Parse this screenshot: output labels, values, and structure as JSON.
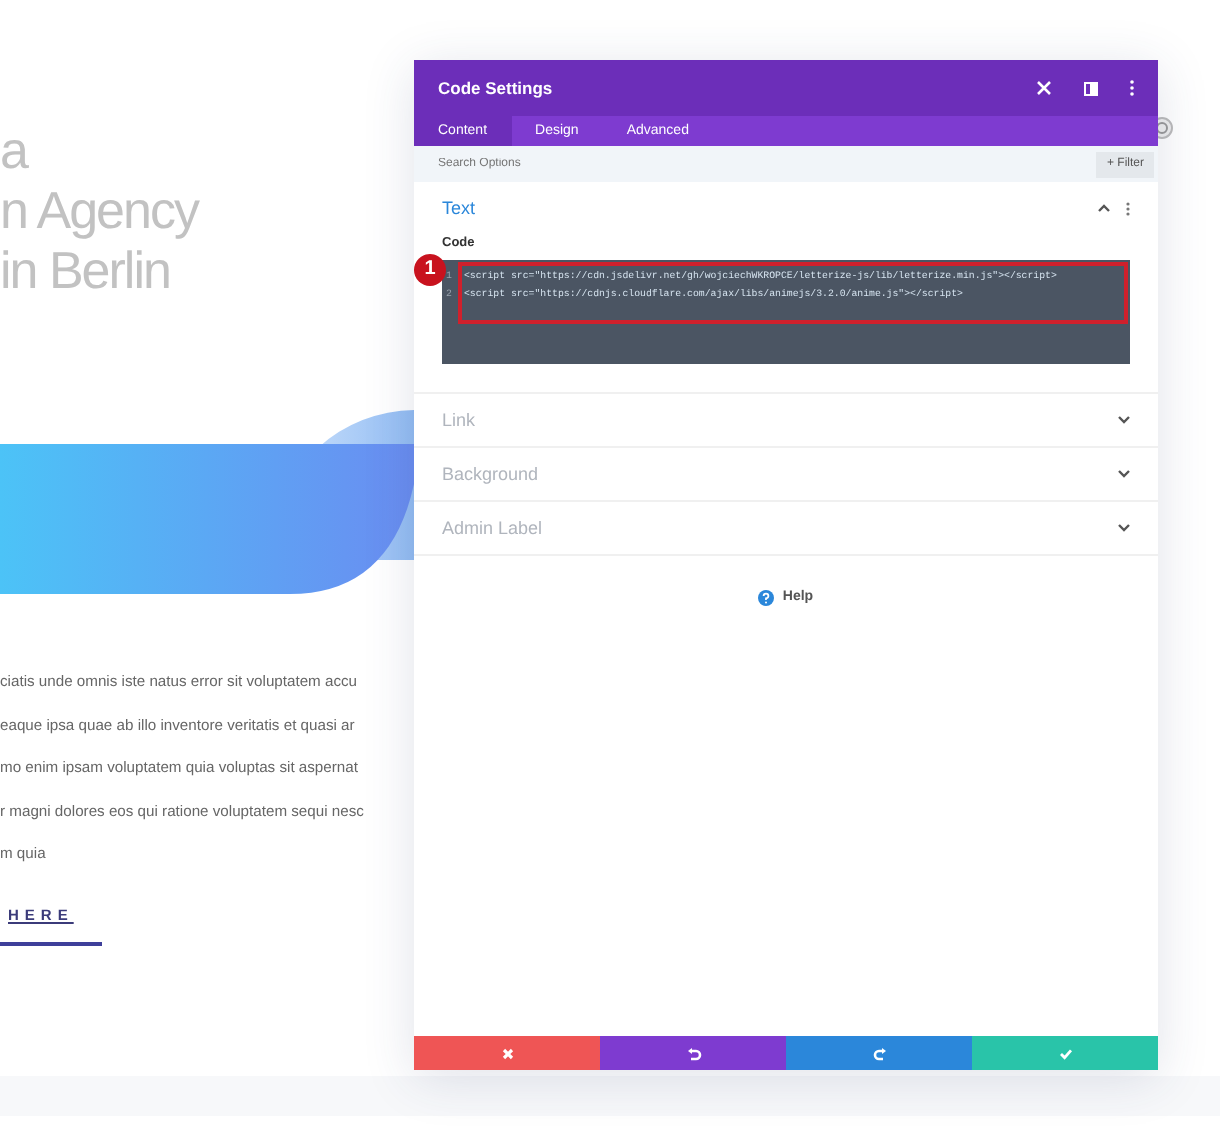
{
  "page": {
    "headline_lines": [
      "a",
      "n Agency",
      "in Berlin"
    ],
    "paragraph_lines": [
      "ciatis unde omnis iste natus error sit voluptatem accu",
      "eaque ipsa quae ab illo inventore veritatis et quasi ar",
      "mo enim ipsam voluptatem quia voluptas sit aspernat",
      "r magni dolores eos qui ratione voluptatem sequi nesc",
      "m quia"
    ],
    "button": "HERE"
  },
  "modal": {
    "title": "Code Settings",
    "tabs": [
      {
        "label": "Content",
        "selected": true
      },
      {
        "label": "Design",
        "selected": false
      },
      {
        "label": "Advanced",
        "selected": false
      }
    ],
    "search": {
      "placeholder": "Search Options"
    },
    "filter_button": "+ Filter",
    "sections": [
      {
        "title": "Text",
        "expanded": true,
        "field_label": "Code",
        "annotation": "1",
        "code_lines": [
          {
            "number": "1",
            "text": "<script src=\"https://cdn.jsdelivr.net/gh/wojciechWKROPCE/letterize-js/lib/letterize.min.js\"></script>"
          },
          {
            "number": "2",
            "text": "<script src=\"https://cdnjs.cloudflare.com/ajax/libs/animejs/3.2.0/anime.js\"></script>"
          }
        ]
      },
      {
        "title": "Link",
        "expanded": false
      },
      {
        "title": "Background",
        "expanded": false
      },
      {
        "title": "Admin Label",
        "expanded": false
      }
    ],
    "help": "Help",
    "footer_buttons": [
      {
        "kind": "discard",
        "color": "#ef5555"
      },
      {
        "kind": "undo",
        "color": "#7e3bd0"
      },
      {
        "kind": "redo",
        "color": "#2b87da"
      },
      {
        "kind": "save",
        "color": "#29c4a9"
      }
    ]
  }
}
